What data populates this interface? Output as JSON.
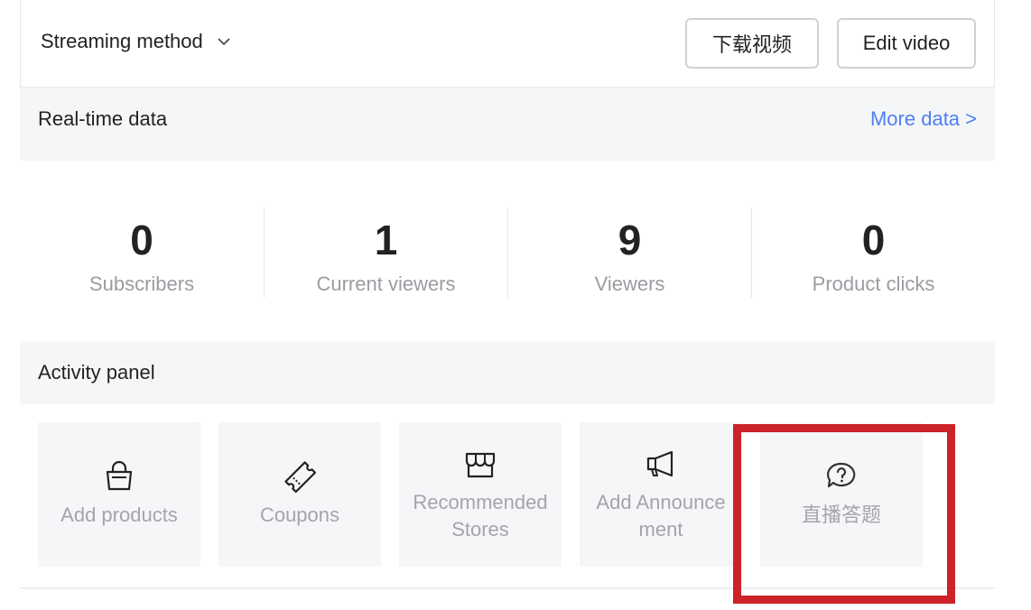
{
  "header": {
    "streaming_method_label": "Streaming method",
    "download_button": "下载视频",
    "edit_button": "Edit video"
  },
  "realtime": {
    "title": "Real-time data",
    "more_link": "More data >"
  },
  "stats": [
    {
      "value": "0",
      "label": "Subscribers"
    },
    {
      "value": "1",
      "label": "Current viewers"
    },
    {
      "value": "9",
      "label": "Viewers"
    },
    {
      "value": "0",
      "label": "Product clicks"
    }
  ],
  "activity": {
    "title": "Activity panel",
    "tiles": [
      {
        "label": "Add products",
        "icon": "shopping-bag-icon"
      },
      {
        "label": "Coupons",
        "icon": "ticket-icon"
      },
      {
        "label_line1": "Recommended",
        "label_line2": "Stores",
        "icon": "store-icon"
      },
      {
        "label_line1": "Add Announce",
        "label_line2": "ment",
        "icon": "megaphone-icon"
      },
      {
        "label": "直播答题",
        "icon": "question-bubble-icon"
      }
    ]
  },
  "colors": {
    "link": "#4e7ff0",
    "highlight": "#cc2229",
    "panel_bg": "#f5f6f8"
  }
}
